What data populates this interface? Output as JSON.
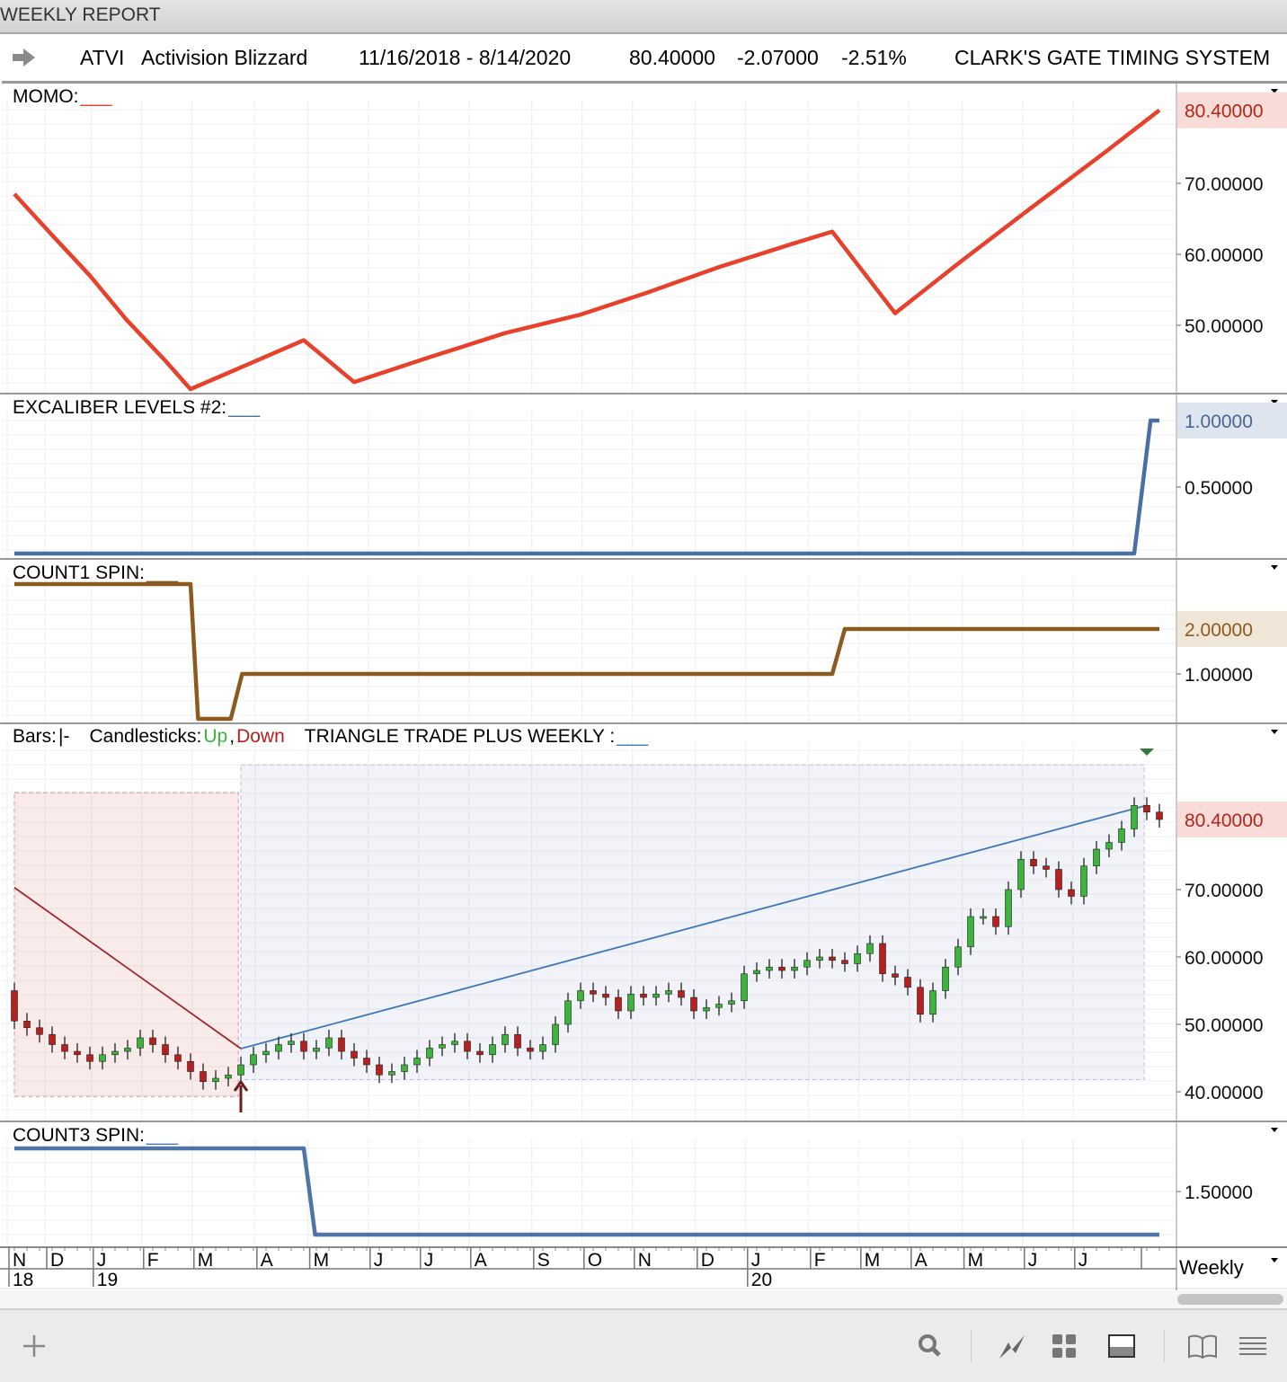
{
  "window": {
    "title": "WEEKLY REPORT"
  },
  "header": {
    "symbol": "ATVI",
    "name": "Activision Blizzard",
    "date_range": "11/16/2018 - 8/14/2020",
    "last": "80.40000",
    "change": "-2.07000",
    "change_pct": "-2.51%",
    "system": "CLARK'S GATE TIMING SYSTEM"
  },
  "colors": {
    "momo": "#e8402a",
    "excaliber": "#4a6fa5",
    "count1": "#8b5a1e",
    "count3": "#4f74a8",
    "up": "#3cb43c",
    "down": "#b82020",
    "triangle_line": "#3f78b8",
    "entry_line": "#a0282a"
  },
  "timeframe": "Weekly",
  "chart_data": [
    {
      "type": "line",
      "title": "MOMO:",
      "legend_mark": "___",
      "y_ticks": [
        "70.00000",
        "60.00000",
        "50.00000"
      ],
      "y_tick_values": [
        70,
        60,
        50
      ],
      "last_label": "80.40000",
      "points": [
        [
          0,
          68.5
        ],
        [
          3,
          62.7
        ],
        [
          6,
          57
        ],
        [
          8.9,
          50.8
        ],
        [
          12,
          45
        ],
        [
          14,
          41
        ],
        [
          23,
          47.9
        ],
        [
          27,
          42
        ],
        [
          33,
          45.5
        ],
        [
          39,
          48.9
        ],
        [
          45,
          51.5
        ],
        [
          50.3,
          54.6
        ],
        [
          56,
          58.2
        ],
        [
          61.7,
          61.4
        ],
        [
          65,
          63.2
        ],
        [
          70,
          51.7
        ],
        [
          75.3,
          59.1
        ],
        [
          81,
          66.8
        ],
        [
          86.7,
          74.4
        ],
        [
          91,
          80.3
        ]
      ],
      "ylim": [
        40,
        84
      ]
    },
    {
      "type": "line",
      "title": "EXCALIBER LEVELS #2:",
      "legend_mark": "___",
      "y_ticks": [
        "0.50000"
      ],
      "y_tick_values": [
        0.5
      ],
      "last_label": "1.00000",
      "points": [
        [
          0,
          0
        ],
        [
          89,
          0
        ],
        [
          90.3,
          1
        ],
        [
          91,
          1
        ]
      ],
      "ylim": [
        -0.05,
        1.1
      ]
    },
    {
      "type": "line",
      "title": "COUNT1 SPIN:",
      "legend_mark": "___",
      "y_ticks": [
        "1.00000"
      ],
      "y_tick_values": [
        1
      ],
      "last_label": "2.00000",
      "points": [
        [
          0,
          3
        ],
        [
          14,
          3
        ],
        [
          14.6,
          0
        ],
        [
          17.2,
          0
        ],
        [
          18.1,
          1
        ],
        [
          65,
          1
        ],
        [
          66,
          2
        ],
        [
          91,
          2
        ]
      ],
      "ylim": [
        -0.1,
        3.3
      ]
    },
    {
      "type": "candlestick",
      "title": "TRIANGLE TRADE PLUS WEEKLY :",
      "legend_mark": "___",
      "legend": {
        "bars": "Bars:",
        "bars_mark": "|-",
        "candles": "Candlesticks:",
        "up": "Up",
        "comma": ",",
        "down": "Down"
      },
      "y_ticks": [
        "70.00000",
        "60.00000",
        "50.00000",
        "40.00000"
      ],
      "y_tick_values": [
        70,
        60,
        50,
        40
      ],
      "last_label": "80.40000",
      "closes": [
        50.5,
        49.5,
        48.5,
        47,
        46,
        45.5,
        44.5,
        45.5,
        46,
        46.5,
        48,
        47,
        45.5,
        44.5,
        43,
        41.5,
        42,
        42.5,
        44,
        45.5,
        46,
        47,
        47.5,
        46,
        46.5,
        48,
        46,
        45,
        44,
        42.5,
        43,
        44,
        45,
        46.5,
        47,
        47.5,
        46,
        45.5,
        47,
        48.5,
        46.5,
        46,
        47,
        50,
        53.5,
        55,
        54.5,
        54,
        52,
        54.5,
        54,
        54.5,
        55,
        54,
        52,
        52.5,
        53,
        53.5,
        57.5,
        58,
        58.5,
        58,
        58.5,
        59.5,
        60,
        59.5,
        59,
        60.5,
        62,
        57.5,
        57,
        55.5,
        51.5,
        55,
        58.5,
        61.5,
        66,
        66,
        64.5,
        70,
        74.5,
        73.5,
        73,
        70,
        69,
        73.5,
        76,
        77,
        79,
        82.5,
        81.5,
        80.4
      ],
      "first_open": 55,
      "setup_zone": {
        "start_week": 0,
        "end_week": 17.8,
        "top": 84.4,
        "bottom": 39.3
      },
      "trade_zone": {
        "start_week": 18,
        "end_week": 89.8,
        "top": 88.5,
        "bottom": 41.8
      },
      "entry_line": [
        [
          0,
          70.3
        ],
        [
          18,
          46.4
        ]
      ],
      "triangle_line": [
        [
          18,
          46.4
        ],
        [
          89.8,
          82.4
        ]
      ],
      "ylim": [
        37,
        91
      ]
    },
    {
      "type": "line",
      "title": "COUNT3 SPIN:",
      "legend_mark": "___",
      "y_ticks": [
        "1.50000"
      ],
      "y_tick_values": [
        1.5
      ],
      "points": [
        [
          0,
          2
        ],
        [
          23,
          2
        ],
        [
          23.9,
          1
        ],
        [
          91,
          1
        ]
      ],
      "ylim": [
        0.86,
        2.3
      ]
    }
  ],
  "x_axis": {
    "months": [
      [
        "N",
        0
      ],
      [
        "D",
        3
      ],
      [
        "J",
        6.7
      ],
      [
        "F",
        10.7
      ],
      [
        "M",
        14.7
      ],
      [
        "A",
        19.7
      ],
      [
        "M",
        23.9
      ],
      [
        "J",
        28.7
      ],
      [
        "J",
        32.7
      ],
      [
        "A",
        36.7
      ],
      [
        "S",
        41.7
      ],
      [
        "O",
        45.7
      ],
      [
        "N",
        49.7
      ],
      [
        "D",
        54.7
      ],
      [
        "J",
        58.7
      ],
      [
        "F",
        63.7
      ],
      [
        "M",
        67.7
      ],
      [
        "A",
        71.7
      ],
      [
        "M",
        75.9
      ],
      [
        "J",
        80.7
      ],
      [
        "J",
        84.7
      ]
    ],
    "years": [
      [
        "18",
        0
      ],
      [
        "19",
        6.7
      ],
      [
        "20",
        58.7
      ]
    ]
  }
}
